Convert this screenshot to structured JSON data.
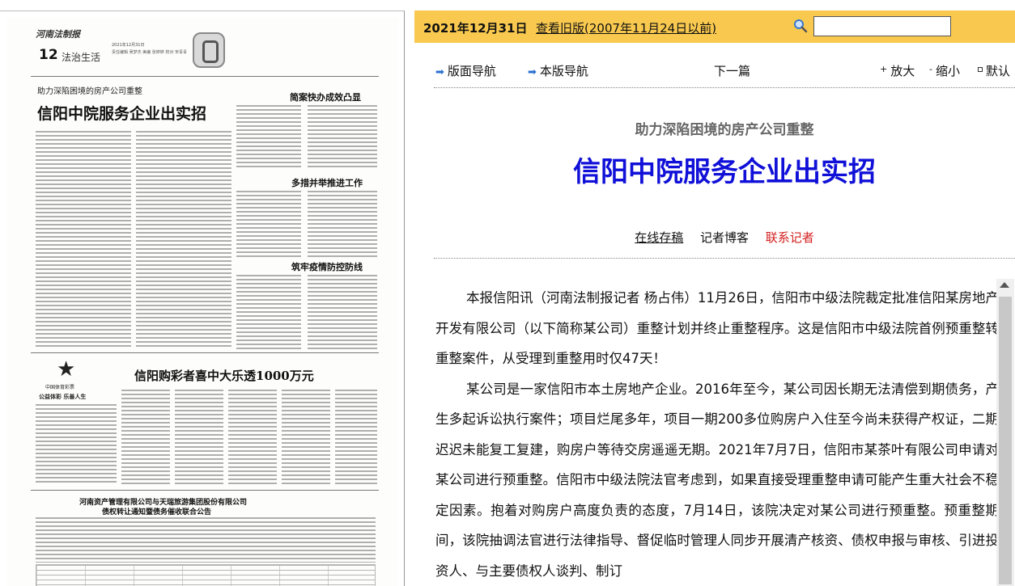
{
  "newspaper": {
    "brand": "河南法制报",
    "date": "2021年12月31日",
    "page_number": "12",
    "section": "法治生活",
    "editors": "责任编辑 吴梦杰 美编 张婷婷 校对 宋青青",
    "kicker": "助力深陷困境的房产公司重整",
    "headline": "信阳中院服务企业出实招",
    "side_heads": [
      "简案快办成效凸显",
      "多措并举推进工作",
      "筑牢疫情防控防线"
    ],
    "lottery_name": "中国体育彩票",
    "lottery_slogan": "公益体彩 乐善人生",
    "lottery_headline": "信阳购彩者喜中大乐透1000万元",
    "notice_title_1": "河南资产管理有限公司与天瑞旅游集团股份有限公司",
    "notice_title_2": "债权转让通知暨债务催收联合公告"
  },
  "topbar": {
    "date": "2021年12月31日",
    "old_version": "查看旧版(2007年11月24日以前)",
    "search_icon": "search-icon",
    "search_value": ""
  },
  "nav": {
    "page_nav": "版面导航",
    "this_page_nav": "本版导航",
    "next": "下一篇",
    "zoom_in": "放大",
    "zoom_out": "缩小",
    "default": "默认"
  },
  "article": {
    "kicker": "助力深陷困境的房产公司重整",
    "headline": "信阳中院服务企业出实招",
    "link_submit": "在线存稿",
    "link_blog": "记者博客",
    "link_contact": "联系记者",
    "paragraphs": [
      "本报信阳讯（河南法制报记者 杨占伟）11月26日，信阳市中级法院裁定批准信阳某房地产开发有限公司（以下简称某公司）重整计划并终止重整程序。这是信阳市中级法院首例预重整转重整案件，从受理到重整用时仅47天！",
      "某公司是一家信阳市本土房地产企业。2016年至今，某公司因长期无法清偿到期债务，产生多起诉讼执行案件；项目烂尾多年，项目一期200多位购房户入住至今尚未获得产权证，二期迟迟未能复工复建，购房户等待交房遥遥无期。2021年7月7日，信阳市某茶叶有限公司申请对某公司进行预重整。信阳市中级法院法官考虑到，如果直接受理重整申请可能产生重大社会不稳定因素。抱着对购房户高度负责的态度，7月14日，该院决定对某公司进行预重整。预重整期间，该院抽调法官进行法律指导、督促临时管理人同步开展清产核资、债权申报与审核、引进投资人、与主要债权人谈判、制订"
    ]
  },
  "colors": {
    "topbar_bg": "#f9c94f",
    "headline": "#1010d8",
    "contact_link": "#d42020",
    "kicker": "#666666"
  }
}
